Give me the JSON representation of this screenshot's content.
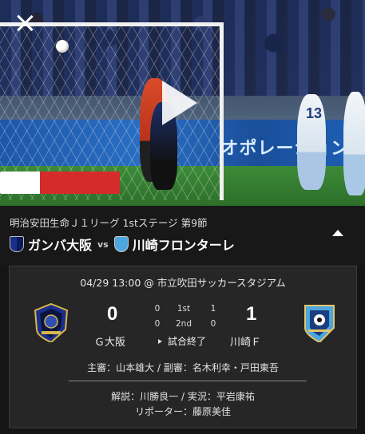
{
  "video": {
    "adboard_text": "オポレーション",
    "jersey_number": "13"
  },
  "header": {
    "competition": "明治安田生命Ｊ１リーグ 1stステージ 第9節",
    "home_team": "ガンバ大阪",
    "vs": "vs",
    "away_team": "川崎フロンターレ"
  },
  "match": {
    "datetime_venue": "04/29 13:00 @ 市立吹田サッカースタジアム",
    "home_score": "0",
    "away_score": "1",
    "periods": [
      {
        "home": "0",
        "label": "1st",
        "away": "1"
      },
      {
        "home": "0",
        "label": "2nd",
        "away": "0"
      }
    ],
    "home_short": "Ｇ大阪",
    "away_short": "川崎Ｆ",
    "status": "試合終了",
    "referees": "主審：山本雄大 / 副審：名木利幸・戸田東吾",
    "commentary": "解説：川勝良一 / 実況：平岩康祐",
    "reporter": "リポーター：藤原美佳"
  },
  "colors": {
    "background": "#151515",
    "card": "#262626",
    "gamba_blue": "#1a2f8a",
    "frontale_blue": "#4da6dd"
  }
}
